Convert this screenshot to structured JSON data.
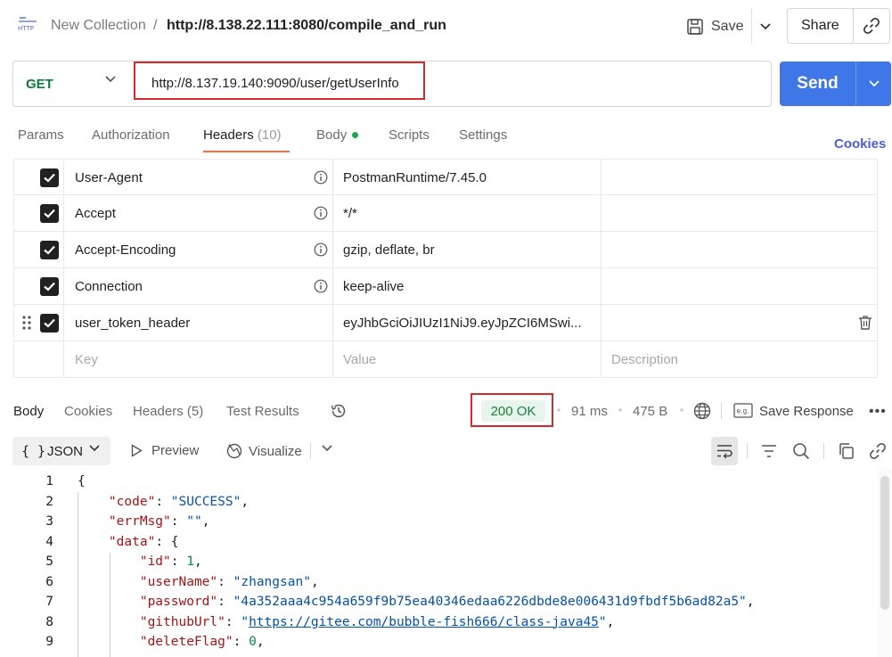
{
  "breadcrumb": {
    "collection": "New Collection",
    "separator": "/",
    "request_title": "http://8.138.22.111:8080/compile_and_run"
  },
  "toolbar": {
    "save_label": "Save",
    "share_label": "Share"
  },
  "request": {
    "method": "GET",
    "url": "http://8.137.19.140:9090/user/getUserInfo",
    "send_label": "Send"
  },
  "request_tabs": {
    "params": "Params",
    "authorization": "Authorization",
    "headers": "Headers",
    "headers_count": "(10)",
    "body": "Body",
    "scripts": "Scripts",
    "settings": "Settings",
    "cookies": "Cookies"
  },
  "headers_table": {
    "rows": [
      {
        "key": "User-Agent",
        "value": "PostmanRuntime/7.45.0"
      },
      {
        "key": "Accept",
        "value": "*/*"
      },
      {
        "key": "Accept-Encoding",
        "value": "gzip, deflate, br"
      },
      {
        "key": "Connection",
        "value": "keep-alive"
      },
      {
        "key": "user_token_header",
        "value": "eyJhbGciOiJIUzI1NiJ9.eyJpZCI6MSwi..."
      }
    ],
    "placeholder_key": "Key",
    "placeholder_value": "Value",
    "placeholder_description": "Description"
  },
  "response_tabs": {
    "body": "Body",
    "cookies": "Cookies",
    "headers": "Headers (5)",
    "test_results": "Test Results"
  },
  "response_meta": {
    "status": "200 OK",
    "time": "91 ms",
    "size": "475 B",
    "save_response": "Save Response",
    "more": "•••"
  },
  "response_toolbar": {
    "format_braces": "{ }",
    "format": "JSON",
    "preview": "Preview",
    "visualize": "Visualize"
  },
  "code_lines": [
    {
      "n": "1",
      "parts": [
        [
          "p",
          "{"
        ]
      ]
    },
    {
      "n": "2",
      "parts": [
        [
          "p",
          "    "
        ],
        [
          "k",
          "\"code\""
        ],
        [
          "p",
          ": "
        ],
        [
          "s",
          "\"SUCCESS\""
        ],
        [
          "p",
          ","
        ]
      ]
    },
    {
      "n": "3",
      "parts": [
        [
          "p",
          "    "
        ],
        [
          "k",
          "\"errMsg\""
        ],
        [
          "p",
          ": "
        ],
        [
          "s",
          "\"\""
        ],
        [
          "p",
          ","
        ]
      ]
    },
    {
      "n": "4",
      "parts": [
        [
          "p",
          "    "
        ],
        [
          "k",
          "\"data\""
        ],
        [
          "p",
          ": {"
        ]
      ]
    },
    {
      "n": "5",
      "parts": [
        [
          "p",
          "        "
        ],
        [
          "k",
          "\"id\""
        ],
        [
          "p",
          ": "
        ],
        [
          "n",
          "1"
        ],
        [
          "p",
          ","
        ]
      ]
    },
    {
      "n": "6",
      "parts": [
        [
          "p",
          "        "
        ],
        [
          "k",
          "\"userName\""
        ],
        [
          "p",
          ": "
        ],
        [
          "s",
          "\"zhangsan\""
        ],
        [
          "p",
          ","
        ]
      ]
    },
    {
      "n": "7",
      "parts": [
        [
          "p",
          "        "
        ],
        [
          "k",
          "\"password\""
        ],
        [
          "p",
          ": "
        ],
        [
          "s",
          "\"4a352aaa4c954a659f9b75ea40346edaa6226dbde8e006431d9fbdf5b6ad82a5\""
        ],
        [
          "p",
          ","
        ]
      ]
    },
    {
      "n": "8",
      "parts": [
        [
          "p",
          "        "
        ],
        [
          "k",
          "\"githubUrl\""
        ],
        [
          "p",
          ": "
        ],
        [
          "s",
          "\""
        ],
        [
          "u",
          "https://gitee.com/bubble-fish666/class-java45"
        ],
        [
          "s",
          "\""
        ],
        [
          "p",
          ","
        ]
      ]
    },
    {
      "n": "9",
      "parts": [
        [
          "p",
          "        "
        ],
        [
          "k",
          "\"deleteFlag\""
        ],
        [
          "p",
          ": "
        ],
        [
          "n",
          "0"
        ],
        [
          "p",
          ","
        ]
      ]
    }
  ]
}
